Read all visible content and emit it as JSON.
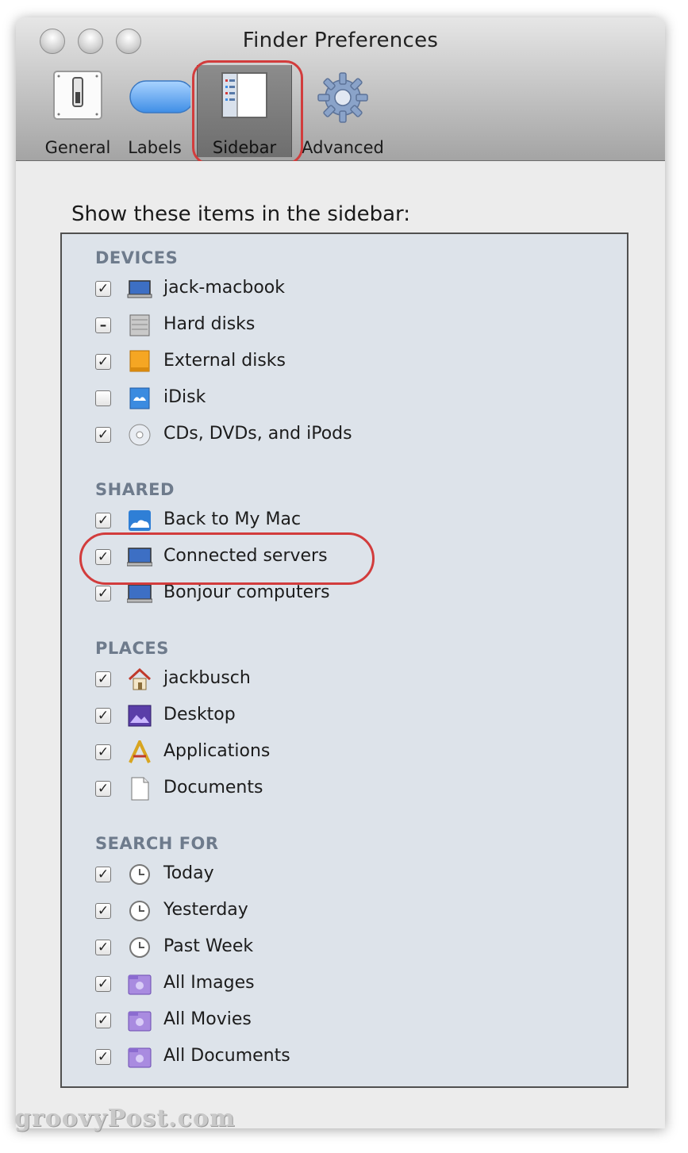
{
  "window": {
    "title": "Finder Preferences"
  },
  "toolbar": {
    "tabs": [
      {
        "label": "General",
        "icon": "switch-icon"
      },
      {
        "label": "Labels",
        "icon": "label-pill-icon"
      },
      {
        "label": "Sidebar",
        "icon": "sidebar-icon",
        "selected": true
      },
      {
        "label": "Advanced",
        "icon": "gear-icon"
      }
    ]
  },
  "content": {
    "heading": "Show these items in the sidebar:",
    "sections": [
      {
        "title": "DEVICES",
        "items": [
          {
            "label": "jack-macbook",
            "state": "checked",
            "icon": "laptop-icon"
          },
          {
            "label": "Hard disks",
            "state": "mixed",
            "icon": "hard-disk-icon"
          },
          {
            "label": "External disks",
            "state": "checked",
            "icon": "external-disk-icon"
          },
          {
            "label": "iDisk",
            "state": "unchecked",
            "icon": "idisk-icon"
          },
          {
            "label": "CDs, DVDs, and iPods",
            "state": "checked",
            "icon": "cd-icon"
          }
        ]
      },
      {
        "title": "SHARED",
        "items": [
          {
            "label": "Back to My Mac",
            "state": "checked",
            "icon": "cloud-icon"
          },
          {
            "label": "Connected servers",
            "state": "checked",
            "icon": "monitor-icon"
          },
          {
            "label": "Bonjour computers",
            "state": "checked",
            "icon": "monitor-icon"
          }
        ]
      },
      {
        "title": "PLACES",
        "items": [
          {
            "label": "jackbusch",
            "state": "checked",
            "icon": "home-icon"
          },
          {
            "label": "Desktop",
            "state": "checked",
            "icon": "desktop-icon"
          },
          {
            "label": "Applications",
            "state": "checked",
            "icon": "applications-icon"
          },
          {
            "label": "Documents",
            "state": "checked",
            "icon": "document-icon"
          }
        ]
      },
      {
        "title": "SEARCH FOR",
        "items": [
          {
            "label": "Today",
            "state": "checked",
            "icon": "clock-icon"
          },
          {
            "label": "Yesterday",
            "state": "checked",
            "icon": "clock-icon"
          },
          {
            "label": "Past Week",
            "state": "checked",
            "icon": "clock-icon"
          },
          {
            "label": "All Images",
            "state": "checked",
            "icon": "smart-folder-icon"
          },
          {
            "label": "All Movies",
            "state": "checked",
            "icon": "smart-folder-icon"
          },
          {
            "label": "All Documents",
            "state": "checked",
            "icon": "smart-folder-icon"
          }
        ]
      }
    ]
  },
  "watermark": "groovyPost.com",
  "colors": {
    "highlight": "#d23c3c",
    "section_title": "#6e7b8c",
    "list_background": "#dde3ea"
  }
}
